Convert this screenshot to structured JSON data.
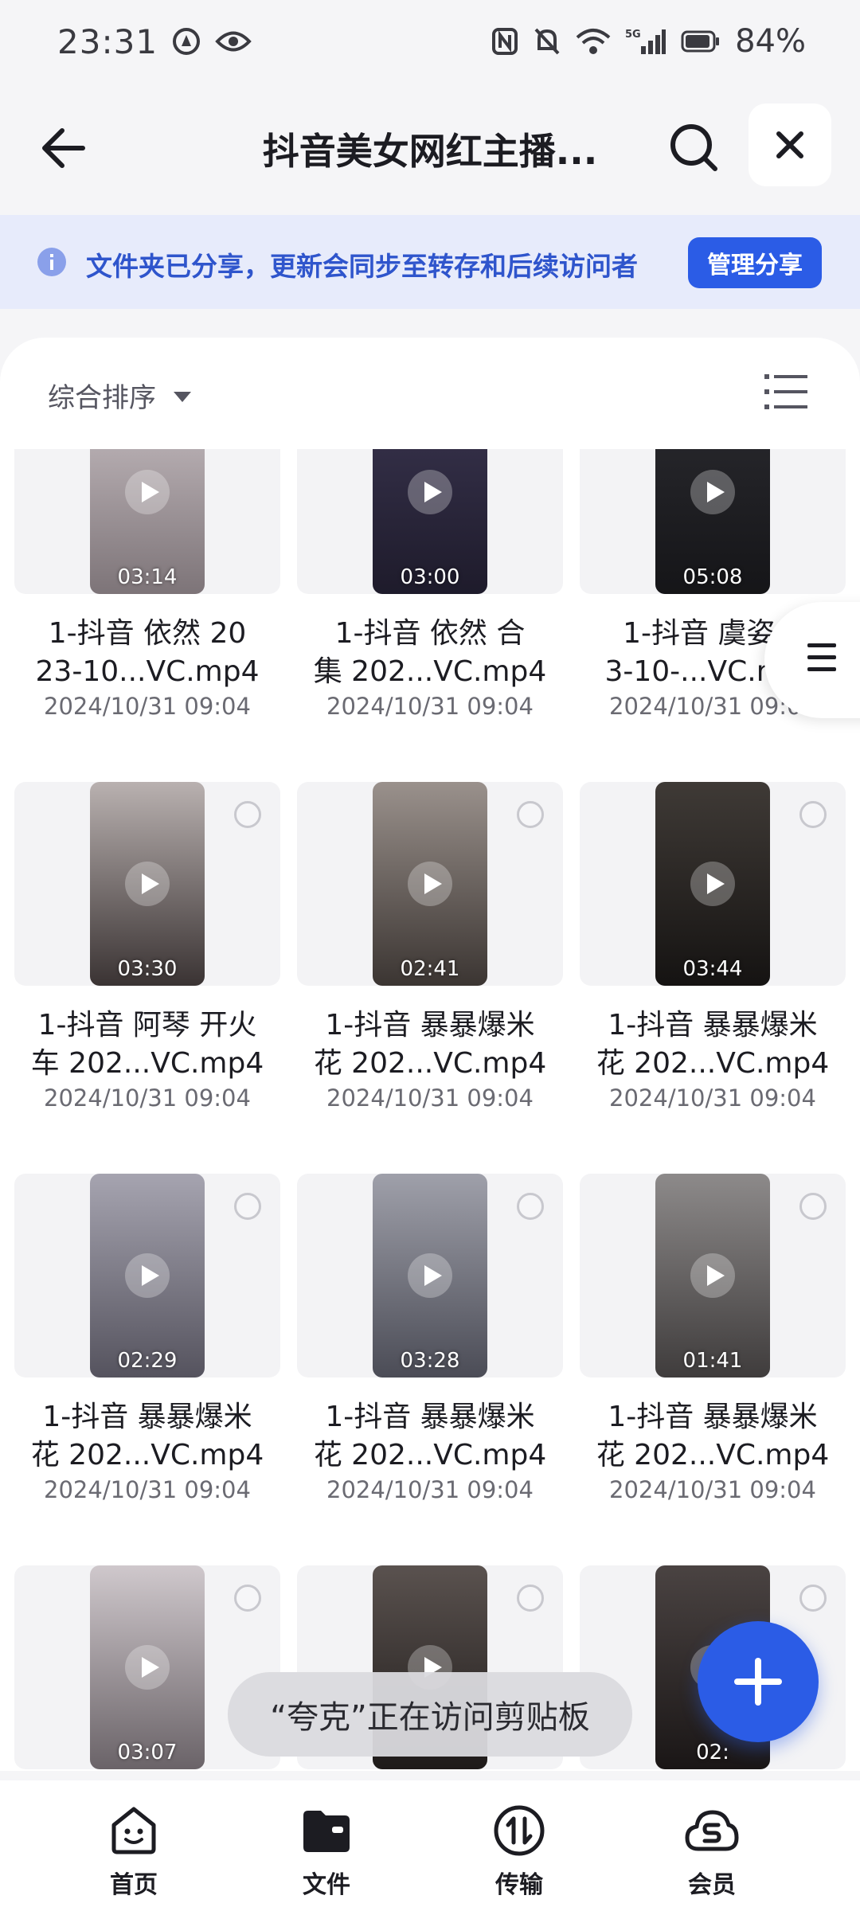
{
  "status_bar": {
    "time": "23:31",
    "battery": "84%",
    "network_label": "5G"
  },
  "header": {
    "title": "抖音美女网红主播..."
  },
  "share_banner": {
    "text": "文件夹已分享，更新会同步至转存和后续访问者",
    "manage_button": "管理分享"
  },
  "toolbar": {
    "sort_label": "综合排序"
  },
  "files": [
    {
      "name": "1-抖音  依然  20\n23-10...VC.mp4",
      "date": "2024/10/31 09:04",
      "duration": "03:14",
      "tone": [
        "#c9c0c4",
        "#7d7478"
      ]
    },
    {
      "name": "1-抖音  依然  合\n集 202...VC.mp4",
      "date": "2024/10/31 09:04",
      "duration": "03:00",
      "tone": [
        "#3a3550",
        "#1e1b2b"
      ]
    },
    {
      "name": "1-抖音  虞姿  2\n3-10-...VC.mp4",
      "date": "2024/10/31 09:04",
      "duration": "05:08",
      "tone": [
        "#2b2b30",
        "#151518"
      ]
    },
    {
      "name": "1-抖音 阿琴 开火\n车 202...VC.mp4",
      "date": "2024/10/31 09:04",
      "duration": "03:30",
      "tone": [
        "#b9b1b0",
        "#3a3333"
      ]
    },
    {
      "name": "1-抖音 暴暴爆米\n花 202...VC.mp4",
      "date": "2024/10/31 09:04",
      "duration": "02:41",
      "tone": [
        "#9a918c",
        "#3b3532"
      ]
    },
    {
      "name": "1-抖音 暴暴爆米\n花 202...VC.mp4",
      "date": "2024/10/31 09:04",
      "duration": "03:44",
      "tone": [
        "#3f3a36",
        "#151312"
      ]
    },
    {
      "name": "1-抖音 暴暴爆米\n花 202...VC.mp4",
      "date": "2024/10/31 09:04",
      "duration": "02:29",
      "tone": [
        "#a6a4b0",
        "#55535e"
      ]
    },
    {
      "name": "1-抖音 暴暴爆米\n花 202...VC.mp4",
      "date": "2024/10/31 09:04",
      "duration": "03:28",
      "tone": [
        "#9fa0aa",
        "#4b4c56"
      ]
    },
    {
      "name": "1-抖音 暴暴爆米\n花 202...VC.mp4",
      "date": "2024/10/31 09:04",
      "duration": "01:41",
      "tone": [
        "#8d8a8a",
        "#3f3c3c"
      ]
    },
    {
      "name": "",
      "date": "",
      "duration": "03:07",
      "tone": [
        "#cfc8cc",
        "#6a6368"
      ]
    },
    {
      "name": "",
      "date": "",
      "duration": "",
      "tone": [
        "#5a524f",
        "#1e1a19"
      ]
    },
    {
      "name": "",
      "date": "",
      "duration": "02:",
      "tone": [
        "#4a4342",
        "#1a1616"
      ]
    }
  ],
  "toast": {
    "text": "“夸克”正在访问剪贴板"
  },
  "bottom_nav": [
    {
      "label": "首页",
      "icon": "home-face-icon"
    },
    {
      "label": "文件",
      "icon": "folder-icon"
    },
    {
      "label": "传输",
      "icon": "transfer-icon"
    },
    {
      "label": "会员",
      "icon": "membership-cloud-icon"
    }
  ],
  "colors": {
    "accent": "#2b5ce6",
    "banner_bg": "#e7ebfb",
    "banner_text": "#2f55cc"
  }
}
